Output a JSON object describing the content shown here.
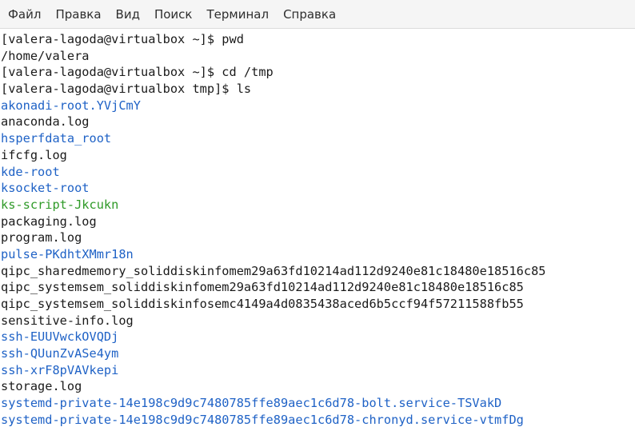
{
  "menu": {
    "items": [
      "Файл",
      "Правка",
      "Вид",
      "Поиск",
      "Терминал",
      "Справка"
    ]
  },
  "colors": {
    "directory": "#1f62c6",
    "executable": "#2f9a28",
    "text": "#1a1a1a",
    "menubar_bg": "#f5f5f5"
  },
  "terminal": {
    "lines": [
      {
        "text": "[valera-lagoda@virtualbox ~]$ pwd",
        "kind": "prompt"
      },
      {
        "text": "/home/valera",
        "kind": "file"
      },
      {
        "text": "[valera-lagoda@virtualbox ~]$ cd /tmp",
        "kind": "prompt"
      },
      {
        "text": "[valera-lagoda@virtualbox tmp]$ ls",
        "kind": "prompt"
      },
      {
        "text": "akonadi-root.YVjCmY",
        "kind": "dir"
      },
      {
        "text": "anaconda.log",
        "kind": "file"
      },
      {
        "text": "hsperfdata_root",
        "kind": "dir"
      },
      {
        "text": "ifcfg.log",
        "kind": "file"
      },
      {
        "text": "kde-root",
        "kind": "dir"
      },
      {
        "text": "ksocket-root",
        "kind": "dir"
      },
      {
        "text": "ks-script-Jkcukn",
        "kind": "exec"
      },
      {
        "text": "packaging.log",
        "kind": "file"
      },
      {
        "text": "program.log",
        "kind": "file"
      },
      {
        "text": "pulse-PKdhtXMmr18n",
        "kind": "dir"
      },
      {
        "text": "qipc_sharedmemory_soliddiskinfomem29a63fd10214ad112d9240e81c18480e18516c85",
        "kind": "file"
      },
      {
        "text": "qipc_systemsem_soliddiskinfomem29a63fd10214ad112d9240e81c18480e18516c85",
        "kind": "file"
      },
      {
        "text": "qipc_systemsem_soliddiskinfosemc4149a4d0835438aced6b5ccf94f57211588fb55",
        "kind": "file"
      },
      {
        "text": "sensitive-info.log",
        "kind": "file"
      },
      {
        "text": "ssh-EUUVwckOVQDj",
        "kind": "dir"
      },
      {
        "text": "ssh-QUunZvASe4ym",
        "kind": "dir"
      },
      {
        "text": "ssh-xrF8pVAVkepi",
        "kind": "dir"
      },
      {
        "text": "storage.log",
        "kind": "file"
      },
      {
        "text": "systemd-private-14e198c9d9c7480785ffe89aec1c6d78-bolt.service-TSVakD",
        "kind": "dir"
      },
      {
        "text": "systemd-private-14e198c9d9c7480785ffe89aec1c6d78-chronyd.service-vtmfDg",
        "kind": "dir"
      }
    ]
  }
}
